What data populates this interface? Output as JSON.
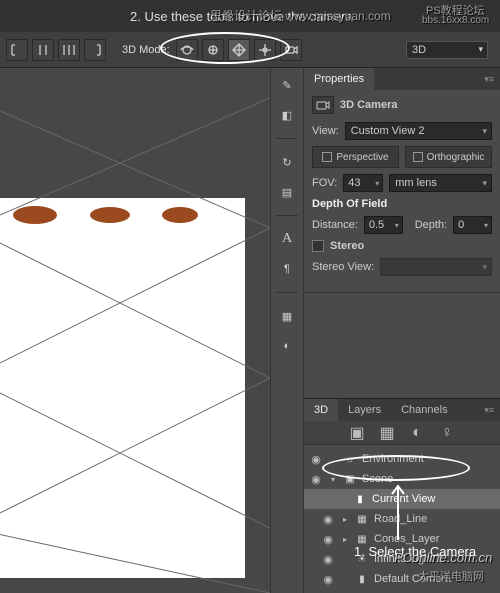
{
  "topbar": {
    "instruction": "2. Use these tools to move the camera"
  },
  "toolbar": {
    "mode_label": "3D Mode:",
    "mode_dd": "3D"
  },
  "properties": {
    "tab": "Properties",
    "title": "3D Camera",
    "view_label": "View:",
    "view_value": "Custom View 2",
    "perspective": "Perspective",
    "orthographic": "Orthographic",
    "fov_label": "FOV:",
    "fov_value": "43",
    "fov_unit": "mm lens",
    "dof_section": "Depth Of Field",
    "distance_label": "Distance:",
    "distance_value": "0.5",
    "depth_label": "Depth:",
    "depth_value": "0",
    "stereo_label": "Stereo",
    "stereo_view_label": "Stereo View:"
  },
  "panel3d": {
    "tabs": [
      "3D",
      "Layers",
      "Channels"
    ],
    "items": {
      "env": "Environment",
      "scene": "Scene",
      "current": "Current View",
      "road": "Road_Line",
      "cones": "Cones_Layer",
      "light": "Infinite Light 1",
      "camera": "Default Camera"
    }
  },
  "bottom_instruction": "1. Select the Camera",
  "wm1": "思缘设计论坛  www.missyuan.com",
  "wm2": "PS教程论坛",
  "wm3": "bbs.16xx8.com",
  "wm4": "PConline.com.cn",
  "wm5": "太平洋电脑网"
}
